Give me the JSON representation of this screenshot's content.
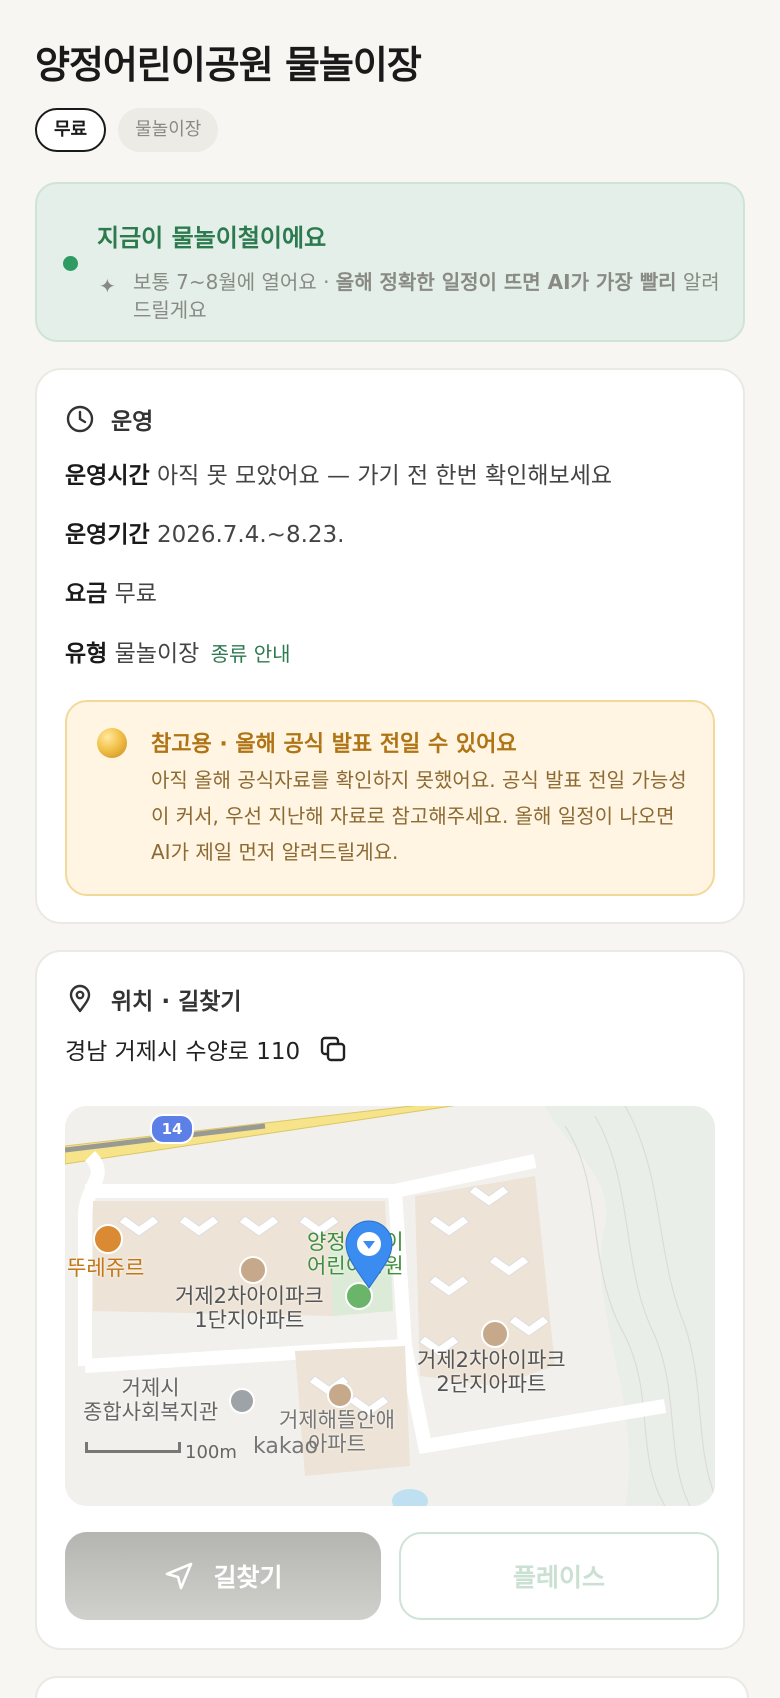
{
  "page": {
    "title": "양정어린이공원 물놀이장",
    "chips": [
      "무료",
      "물놀이장"
    ]
  },
  "season": {
    "headline": "지금이 물놀이철이에요",
    "sub_normal": "보통 7~8월에 열어요 · ",
    "sub_bold": "올해 정확한 일정이 뜨면 AI가 가장 빨리",
    "sub_tail": "알려드릴게요"
  },
  "operation": {
    "heading": "운영",
    "rows": [
      {
        "label": "운영시간",
        "value": "아직 못 모았어요 — 가기 전 한번 확인해보세요"
      },
      {
        "label": "운영기간",
        "value": "2026.7.4.~8.23."
      },
      {
        "label": "요금",
        "value": "무료"
      },
      {
        "label": "유형",
        "value": "물놀이장",
        "link": "종류 안내"
      }
    ],
    "notice": {
      "title": "참고용 · 올해 공식 발표 전일 수 있어요",
      "body": "아직 올해 공식자료를 확인하지 못했어요. 공식 발표 전일 가능성이 커서, 우선 지난해 자료로 참고해주세요. 올해 일정이 나오면 AI가 제일 먼저 알려드릴게요."
    }
  },
  "location": {
    "heading": "위치 · 길찾기",
    "address": "경남 거제시 수양로 110",
    "map": {
      "road_badge": "14",
      "park_label_1": "양정어린이",
      "park_label_2": "어린이공원",
      "place_1": "뚜레쥬르",
      "place_2_a": "거제2차아이파크",
      "place_2_b": "1단지아파트",
      "place_3_a": "거제2차아이파크",
      "place_3_b": "2단지아파트",
      "place_4_a": "거제시",
      "place_4_b": "종합사회복지관",
      "place_5_a": "거제해뜰안애",
      "place_5_b": "아파트",
      "scale": "100m",
      "brand": "kakao"
    },
    "buttons": {
      "route": "길찾기",
      "place": "플레이스"
    }
  },
  "colors": {
    "accent_green": "#2d7a4f",
    "warning_text": "#b07415",
    "pin_blue": "#3b8cf0"
  }
}
